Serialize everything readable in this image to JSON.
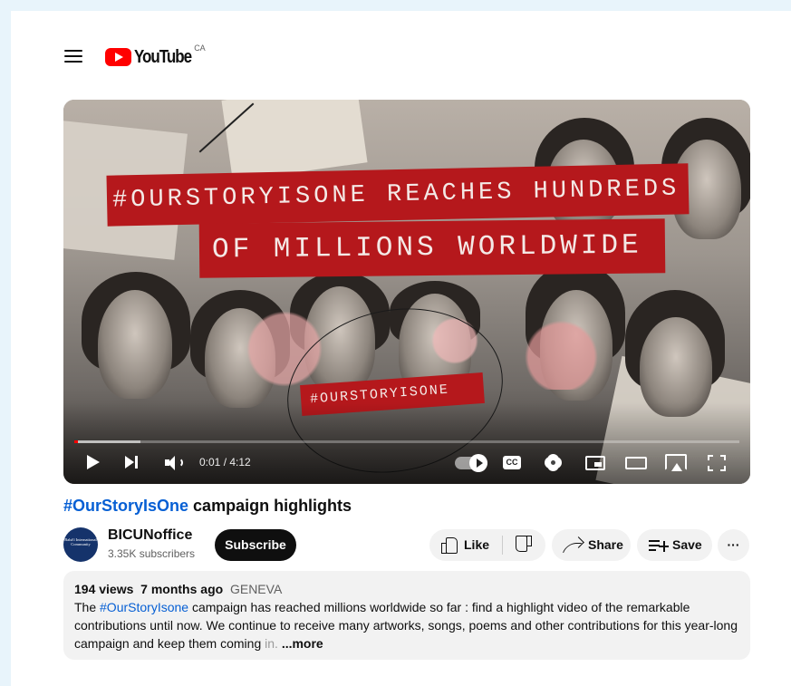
{
  "header": {
    "logo_text": "YouTube",
    "region": "CA"
  },
  "player": {
    "banner_line1": "#OURSTORYISONE REACHES HUNDREDS",
    "banner_line2": "OF MILLIONS WORLDWIDE",
    "hashtag_overlay": "#OURSTORYISONE",
    "time": "0:01 / 4:12",
    "cc_label": "CC",
    "progress_played_fraction": 0.005,
    "progress_loaded_fraction": 0.1
  },
  "video": {
    "title_hashtag": "#OurStoryIsOne",
    "title_rest": " campaign highlights"
  },
  "channel": {
    "name": "BICUNoffice",
    "subscribers": "3.35K subscribers",
    "avatar_text": "Bahá'í International Community",
    "subscribe_label": "Subscribe"
  },
  "actions": {
    "like_label": "Like",
    "share_label": "Share",
    "save_label": "Save",
    "more_label": "···"
  },
  "description": {
    "views": "194 views",
    "age": "7 months ago",
    "location": "GENEVA",
    "text_before": "The ",
    "hashtag": "#OurStoryIsone",
    "text_after": " campaign has reached millions worldwide so far : find a highlight video of the remarkable contributions until now. We continue to receive many artworks, songs, poems and other contributions for this year-long campaign and keep them coming ",
    "faded": "in.",
    "more": "...more"
  },
  "colors": {
    "youtube_red": "#ff0000",
    "banner_red": "#b5181c",
    "link_blue": "#065fd4",
    "page_background": "#e8f4fb"
  },
  "icons": [
    "menu-icon",
    "youtube-play-icon",
    "play-icon",
    "next-icon",
    "volume-icon",
    "autoplay-toggle",
    "cc-icon",
    "settings-gear-icon",
    "miniplayer-icon",
    "theater-mode-icon",
    "airplay-icon",
    "fullscreen-icon",
    "thumbs-up-icon",
    "thumbs-down-icon",
    "share-arrow-icon",
    "save-playlist-icon",
    "more-dots-icon"
  ]
}
